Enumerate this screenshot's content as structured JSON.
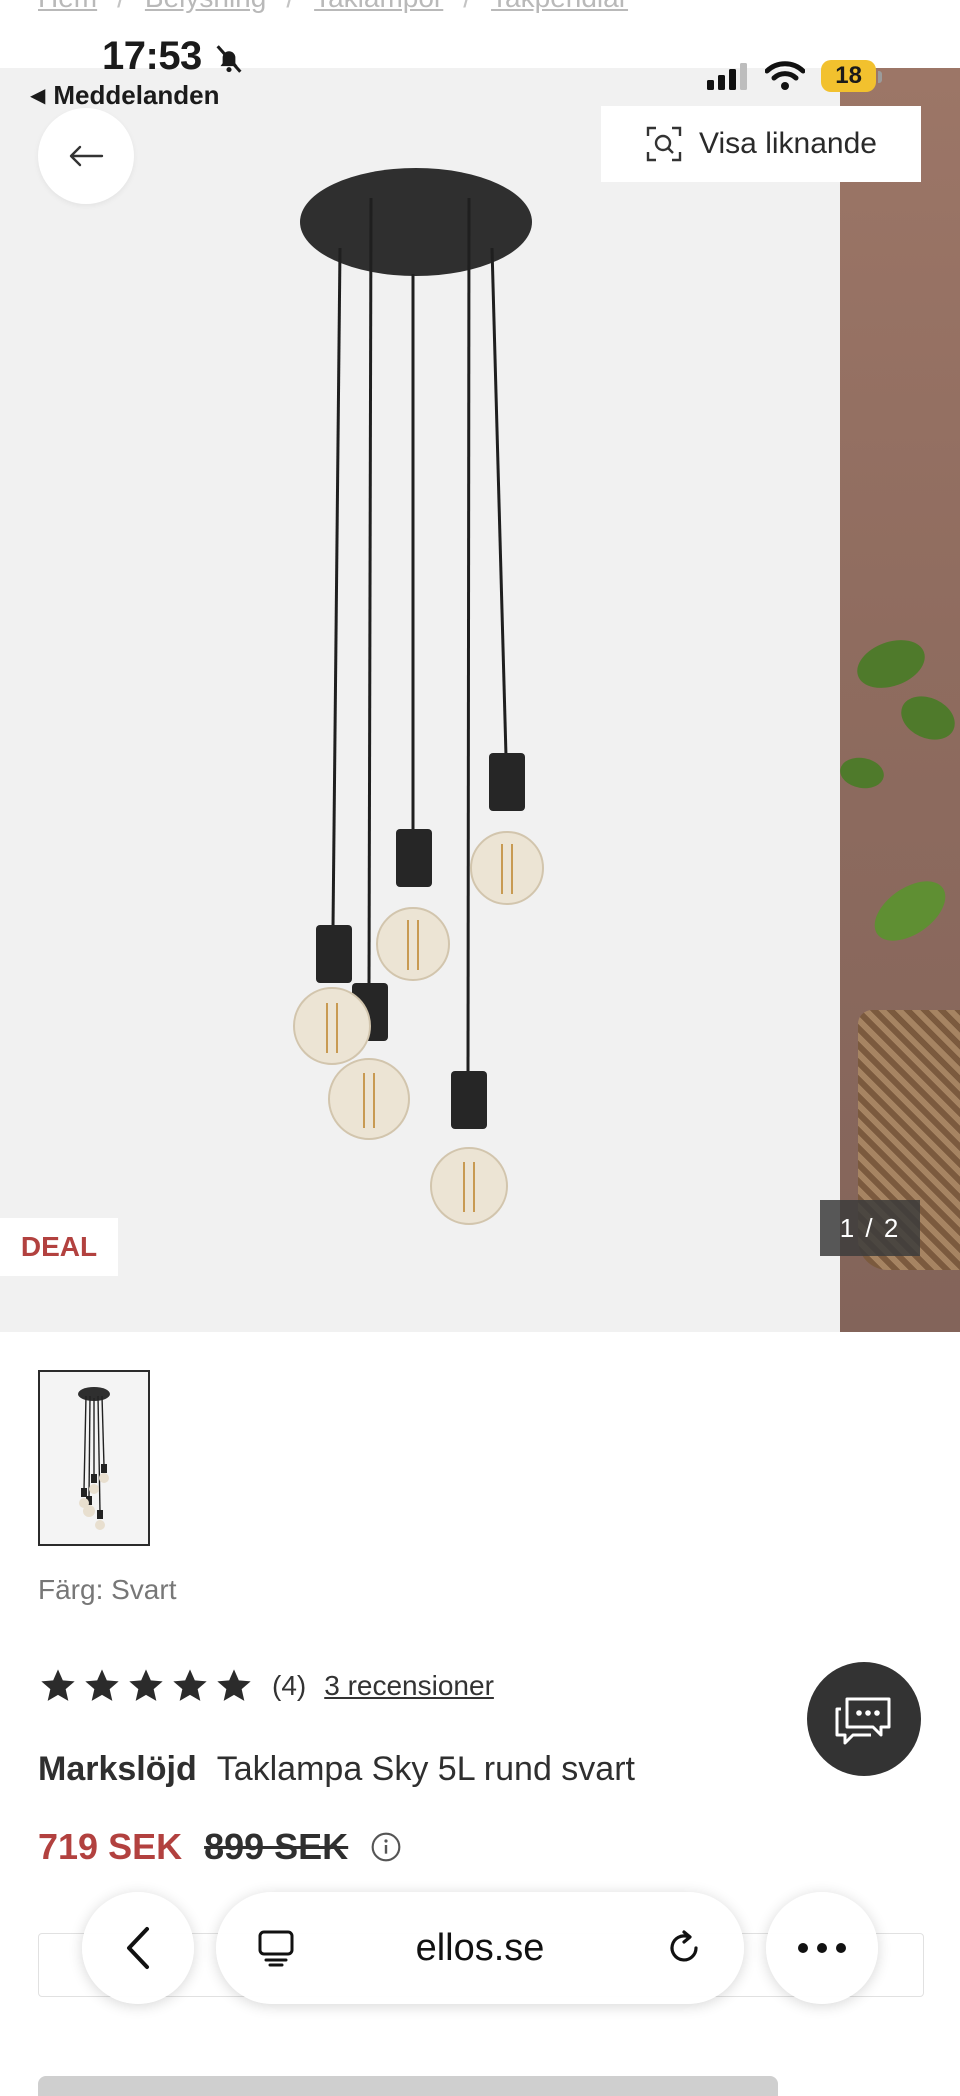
{
  "breadcrumb": [
    "Hem",
    "Belysning",
    "Taklampor",
    "Takpendlar"
  ],
  "status_bar": {
    "time": "17:53",
    "back_app": "Meddelanden",
    "battery": "18"
  },
  "gallery": {
    "similar_label": "Visa liknande",
    "deal_badge": "DEAL",
    "counter": "1 / 2"
  },
  "product": {
    "color_label": "Färg: Svart",
    "rating": 5,
    "review_count": "(4)",
    "reviews_link": "3 recensioner",
    "brand": "Markslöjd",
    "name": "Taklampa Sky 5L rund svart",
    "price": "719 SEK",
    "old_price": "899 SEK"
  },
  "browser": {
    "url": "ellos.se"
  },
  "colors": {
    "accent": "#b2413f",
    "chat_bg": "#333333",
    "battery": "#f2c12e"
  }
}
